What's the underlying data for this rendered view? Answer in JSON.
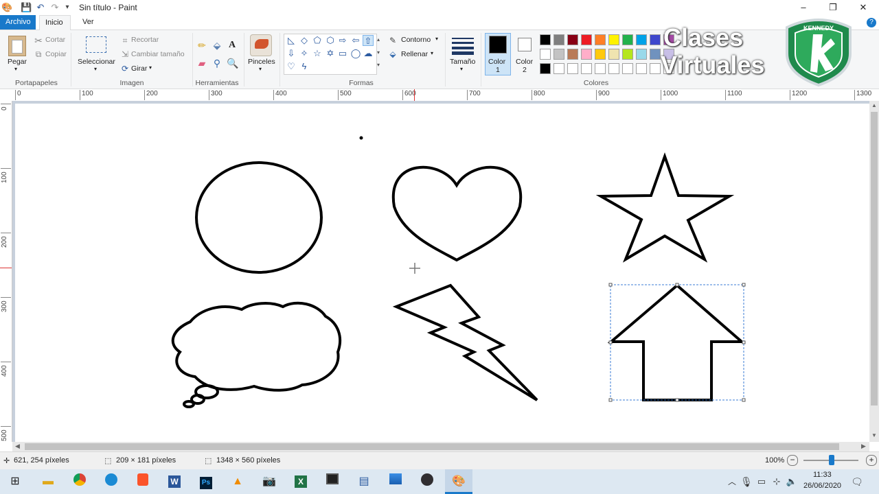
{
  "window": {
    "title": "Sin título - Paint",
    "minimize_icon": "minimize-icon",
    "maximize_icon": "restore-icon",
    "close_icon": "close-icon"
  },
  "tabs": [
    {
      "label": "Archivo"
    },
    {
      "label": "Inicio"
    },
    {
      "label": "Ver"
    }
  ],
  "ribbon": {
    "portapapeles": {
      "label": "Portapapeles",
      "pegar": "Pegar",
      "cortar": "Cortar",
      "copiar": "Copiar"
    },
    "imagen": {
      "label": "Imagen",
      "seleccionar": "Seleccionar",
      "recortar": "Recortar",
      "cambiar": "Cambiar tamaño",
      "girar": "Girar"
    },
    "herramientas": {
      "label": "Herramientas"
    },
    "pinceles": {
      "label": "Pinceles"
    },
    "formas": {
      "label": "Formas",
      "contorno": "Contorno",
      "rellenar": "Rellenar"
    },
    "tamano": {
      "label": "Tamaño"
    },
    "color1": {
      "label": "Color",
      "sub": "1",
      "value": "#000000"
    },
    "color2": {
      "label": "Color",
      "sub": "2",
      "value": "#ffffff"
    },
    "colores": {
      "label": "Colores"
    },
    "palette_row1": [
      "#000000",
      "#7f7f7f",
      "#880015",
      "#ed1c24",
      "#ff7f27",
      "#fff200",
      "#22b14c",
      "#00a2e8",
      "#3f48cc",
      "#a349a4"
    ],
    "palette_row2": [
      "#ffffff",
      "#c3c3c3",
      "#b97a57",
      "#ffaec9",
      "#ffc90e",
      "#efe4b0",
      "#b5e61d",
      "#99d9ea",
      "#7092be",
      "#c8bfe7"
    ],
    "palette_row3": [
      "#000000",
      "#ffffff",
      "#ffffff",
      "#ffffff",
      "#ffffff",
      "#ffffff",
      "#ffffff",
      "#ffffff",
      "#ffffff",
      "#ffffff"
    ]
  },
  "ruler": {
    "top": [
      "0",
      "100",
      "200",
      "300",
      "400",
      "500",
      "600",
      "700",
      "800",
      "900",
      "1000",
      "1100",
      "1200",
      "1300"
    ],
    "left": [
      "0",
      "100",
      "200",
      "300",
      "400",
      "500"
    ]
  },
  "status": {
    "cursor": "621, 254 píxeles",
    "selection": "209 × 181 píxeles",
    "canvas": "1348 × 560 píxeles",
    "zoom": "100%"
  },
  "watermark": {
    "line1": "Clases",
    "line2": "Virtuales"
  },
  "taskbar": {
    "time": "11:33",
    "date": "26/06/2020"
  }
}
